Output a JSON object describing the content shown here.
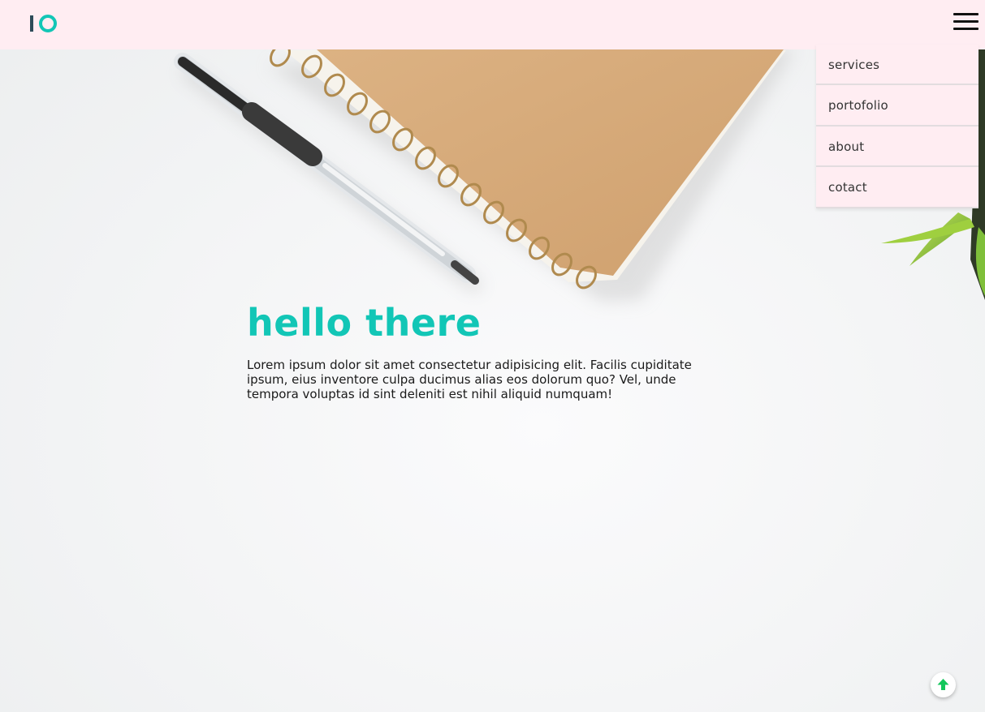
{
  "navbar": {
    "logo_icon": "io-logo",
    "menu_icon": "hamburger-menu-icon"
  },
  "menu": {
    "items": [
      {
        "label": "services"
      },
      {
        "label": "portofolio"
      },
      {
        "label": "about"
      },
      {
        "label": "cotact"
      }
    ]
  },
  "hero": {
    "title": "hello there",
    "description": "Lorem ipsum dolor sit amet consectetur adipisicing elit. Facilis cupiditate ipsum, eius inventore culpa ducimus alias eos dolorum quo? Vel, unde tempora voluptas id sint deleniti est nihil aliquid numquam!"
  },
  "scroll_top": {
    "icon": "arrow-up-icon"
  },
  "colors": {
    "accent": "#12c6b6",
    "navbar_bg": "#ffedf2",
    "logo_dark": "#2d4b58",
    "arrow": "#12c65a"
  }
}
